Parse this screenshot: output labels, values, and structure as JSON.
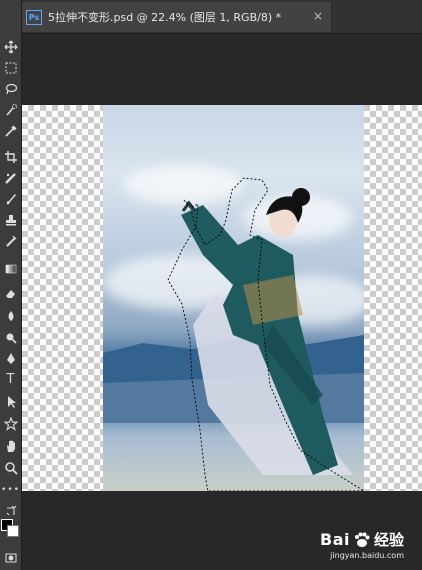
{
  "document": {
    "tab_badge": "Ps",
    "tab_title": "5拉伸不变形.psd @ 22.4% (图层 1, RGB/8) *",
    "tab_close": "×"
  },
  "toolbar": {
    "tools": [
      "move-icon",
      "marquee-icon",
      "lasso-icon",
      "quick-select-icon",
      "eyedropper-icon",
      "crop-icon",
      "spot-heal-icon",
      "brush-icon",
      "clone-stamp-icon",
      "history-brush-icon",
      "eraser-icon",
      "gradient-icon",
      "blur-icon",
      "dodge-icon",
      "pen-icon",
      "type-icon",
      "path-select-icon",
      "shape-icon",
      "hand-icon",
      "zoom-icon",
      "more-tools-icon"
    ],
    "type_glyph": "T",
    "colors": {
      "foreground": "#000000",
      "background": "#ffffff"
    }
  },
  "watermark": {
    "brand": "Bai",
    "brand_suffix": "经验",
    "url": "jingyan.baidu.com"
  },
  "theme": {
    "app_bg": "#282828",
    "panel_bg": "#3c3c3c",
    "tab_bg": "#424242",
    "accent": "#5aa7ff"
  }
}
